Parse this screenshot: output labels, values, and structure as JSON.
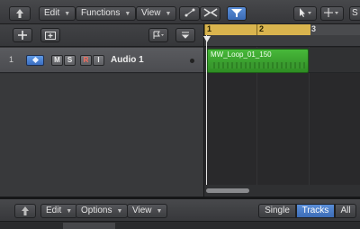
{
  "toolbar": {
    "edit_label": "Edit",
    "functions_label": "Functions",
    "view_label": "View",
    "right_cut_label": "S"
  },
  "track": {
    "number": "1",
    "mute_label": "M",
    "solo_label": "S",
    "record_label": "R",
    "input_label": "I",
    "name": "Audio 1"
  },
  "ruler": {
    "bars": [
      "1",
      "2",
      "3"
    ]
  },
  "region": {
    "name": "MW_Loop_01_150"
  },
  "bottom_toolbar": {
    "edit_label": "Edit",
    "options_label": "Options",
    "view_label": "View",
    "single_label": "Single",
    "tracks_label": "Tracks",
    "all_label": "All"
  },
  "colors": {
    "region": "#3ea531",
    "ruler_cycle": "#d9b44e",
    "accent_blue": "#4a7ec9"
  },
  "icons": {
    "back": "up-arrow-icon",
    "add_track": "plus-icon",
    "pointer": "pointer-tool-icon",
    "crosshair": "marquee-tool-icon"
  }
}
